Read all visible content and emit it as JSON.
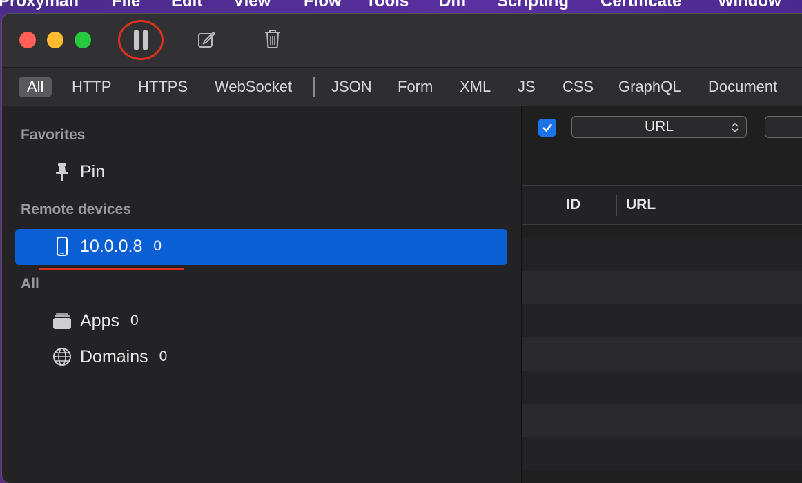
{
  "menubar": {
    "items": [
      "Proxyman",
      "File",
      "Edit",
      "View",
      "Flow",
      "Tools",
      "Diff",
      "Scripting",
      "Certificate",
      "Window"
    ]
  },
  "toolbar": {
    "pause_icon": "pause-icon",
    "compose_icon": "compose-icon",
    "trash_icon": "trash-icon"
  },
  "filters": {
    "items": [
      "All",
      "HTTP",
      "HTTPS",
      "WebSocket",
      "JSON",
      "Form",
      "XML",
      "JS",
      "CSS",
      "GraphQL",
      "Document"
    ],
    "active": "All"
  },
  "sidebar": {
    "favorites_heading": "Favorites",
    "pin_label": "Pin",
    "remote_heading": "Remote devices",
    "device_label": "10.0.0.8",
    "device_count": "0",
    "all_heading": "All",
    "apps_label": "Apps",
    "apps_count": "0",
    "domains_label": "Domains",
    "domains_count": "0"
  },
  "main": {
    "filter_field": "URL",
    "filter_enabled": true,
    "columns": [
      "ID",
      "URL"
    ]
  },
  "colors": {
    "selection": "#0b5fd4",
    "highlight_annotation": "#e0301e"
  }
}
